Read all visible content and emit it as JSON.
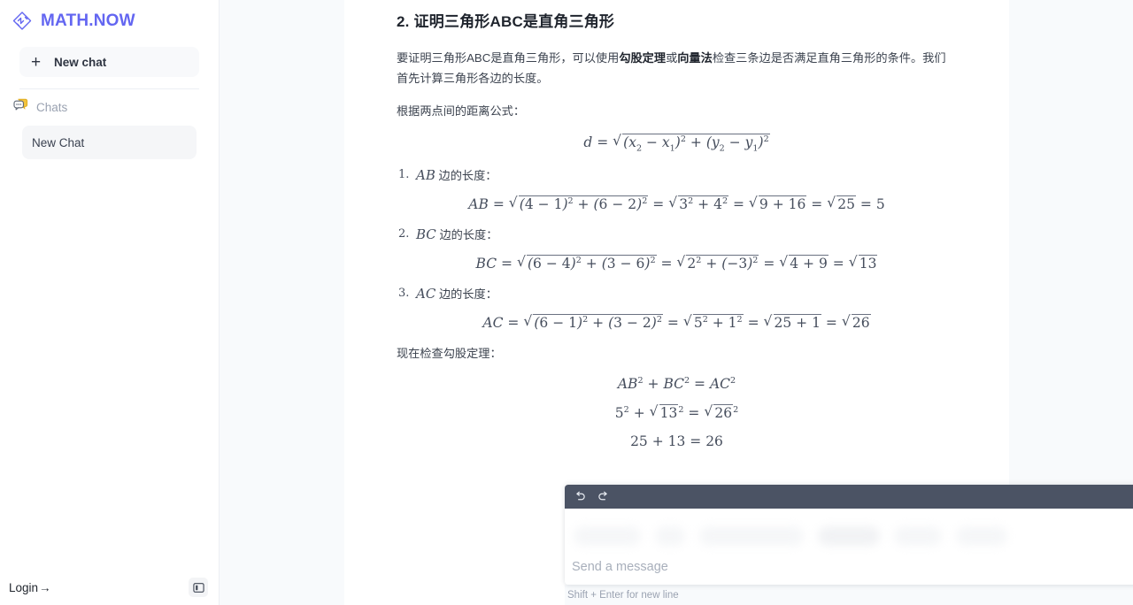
{
  "brand": {
    "name": "MATH.NOW",
    "logo_icon": "diamond-math-logo-icon",
    "accent": "#6366f1"
  },
  "sidebar": {
    "new_chat": {
      "label": "New chat",
      "icon": "plus-icon"
    },
    "chats_section": {
      "label": "Chats",
      "icon": "chat-bubble-icon",
      "icon_color": "#f2c33d"
    },
    "chat_items": [
      {
        "label": "New Chat",
        "active": true
      }
    ],
    "footer": {
      "login_label": "Login",
      "login_arrow": "→",
      "panel_toggle_icon": "sidebar-toggle-icon"
    }
  },
  "document": {
    "section_title": "2. 证明三角形ABC是直角三角形",
    "intro": {
      "p1": "要证明三角形ABC是直角三角形，可以使用",
      "b1": "勾股定理",
      "p2": "或",
      "b2": "向量法",
      "p3": "检查三条边是否满足直角三角形的条件。我们首先计算三角形各边的长度。"
    },
    "distance_lead": "根据两点间的距离公式：",
    "distance_formula": {
      "lhs": "d",
      "eq": "=",
      "radicand": "(x₂ − x₁)² + (y₂ − y₁)²"
    },
    "steps": [
      {
        "name": "AB",
        "head_suffix": " 边的长度：",
        "formula": {
          "lhs": "AB",
          "terms": [
            "√(4 − 1)² + (6 − 2)²",
            "√3² + 4²",
            "√9 + 16",
            "√25",
            "5"
          ]
        }
      },
      {
        "name": "BC",
        "head_suffix": " 边的长度：",
        "formula": {
          "lhs": "BC",
          "terms": [
            "√(6 − 4)² + (3 − 6)²",
            "√2² + (−3)²",
            "√4 + 9",
            "√13"
          ]
        }
      },
      {
        "name": "AC",
        "head_suffix": " 边的长度：",
        "formula": {
          "lhs": "AC",
          "terms": [
            "√(6 − 1)² + (3 − 2)²",
            "√5² + 1²",
            "√25 + 1",
            "√26"
          ]
        }
      }
    ],
    "pythagoras_lead": "现在检查勾股定理：",
    "pythagoras": {
      "line1": "AB² + BC² = AC²",
      "line2": "5² + √13² = √26²",
      "line3": "25 + 13 = 26"
    }
  },
  "composer": {
    "toolbar": {
      "undo_icon": "undo-arrow-icon",
      "redo_icon": "redo-arrow-icon",
      "formula_label": "fx",
      "attach_icon": "paperclip-icon",
      "camera_icon": "camera-icon",
      "separator": "|"
    },
    "placeholder": "Send a message",
    "value": "",
    "send_icon": "send-paper-plane-icon",
    "send_color": "#7c7ff0",
    "hint": "Shift + Enter for new line"
  }
}
